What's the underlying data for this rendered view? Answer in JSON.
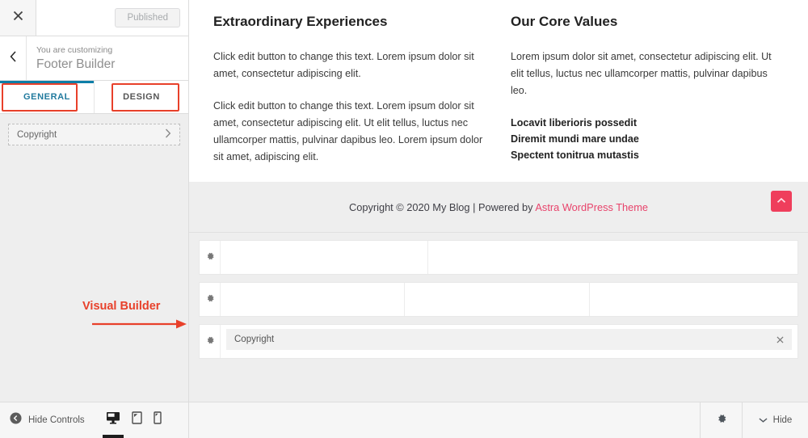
{
  "sidebar": {
    "close_icon": "close-icon",
    "published_label": "Published",
    "back_icon": "chevron-left-icon",
    "customizing_label": "You are customizing",
    "panel_title": "Footer Builder",
    "tabs": [
      {
        "label": "GENERAL",
        "active": true
      },
      {
        "label": "DESIGN",
        "active": false
      }
    ],
    "accordion_items": [
      {
        "label": "Copyright",
        "chevron_icon": "chevron-right-icon"
      }
    ]
  },
  "annotations": {
    "tab_boxes_color": "#e8402a",
    "visual_builder_label": "Visual Builder",
    "arrow_icon": "arrow-right-icon",
    "arrow_color": "#e8402a"
  },
  "preview": {
    "widgets": [
      {
        "title": "Extraordinary Experiences",
        "paragraphs": [
          "Click edit button to change this text. Lorem ipsum dolor sit amet, consectetur adipiscing elit.",
          "Click edit button to change this text. Lorem ipsum dolor sit amet, consectetur adipiscing elit. Ut elit tellus, luctus nec ullamcorper mattis, pulvinar dapibus leo. Lorem ipsum dolor sit amet, adipiscing elit."
        ],
        "list": []
      },
      {
        "title": "Our Core Values",
        "paragraphs": [
          "Lorem ipsum dolor sit amet, consectetur adipiscing elit. Ut elit tellus, luctus nec ullamcorper mattis, pulvinar dapibus leo."
        ],
        "list": [
          "Locavit liberioris possedit",
          "Diremit mundi mare undae",
          "Spectent tonitrua mutastis"
        ]
      }
    ],
    "copyright": {
      "text_before": "Copyright © 2020 My Blog | Powered by ",
      "link_text": "Astra WordPress Theme",
      "link_color": "#e8436b"
    },
    "scroll_top": {
      "icon": "chevron-up-icon",
      "color": "#ef3e5c"
    }
  },
  "builder": {
    "rows": [
      {
        "gear_icon": "gear-icon",
        "columns": [
          {
            "item": null
          },
          {
            "item": null
          }
        ]
      },
      {
        "gear_icon": "gear-icon",
        "columns": [
          {
            "item": null
          },
          {
            "item": null
          },
          {
            "item": null
          }
        ]
      },
      {
        "gear_icon": "gear-icon",
        "columns": [
          {
            "item": "Copyright",
            "remove_icon": "close-icon"
          }
        ]
      }
    ]
  },
  "bottom_bar": {
    "hide_controls_label": "Hide Controls",
    "hide_controls_icon": "arrow-left-circle-icon",
    "devices": [
      {
        "name": "desktop",
        "icon": "desktop-icon",
        "active": true
      },
      {
        "name": "tablet",
        "icon": "tablet-icon",
        "active": false
      },
      {
        "name": "mobile",
        "icon": "mobile-icon",
        "active": false
      }
    ],
    "gear_icon": "gear-icon",
    "hide_label": "Hide",
    "hide_icon": "chevron-down-icon"
  }
}
